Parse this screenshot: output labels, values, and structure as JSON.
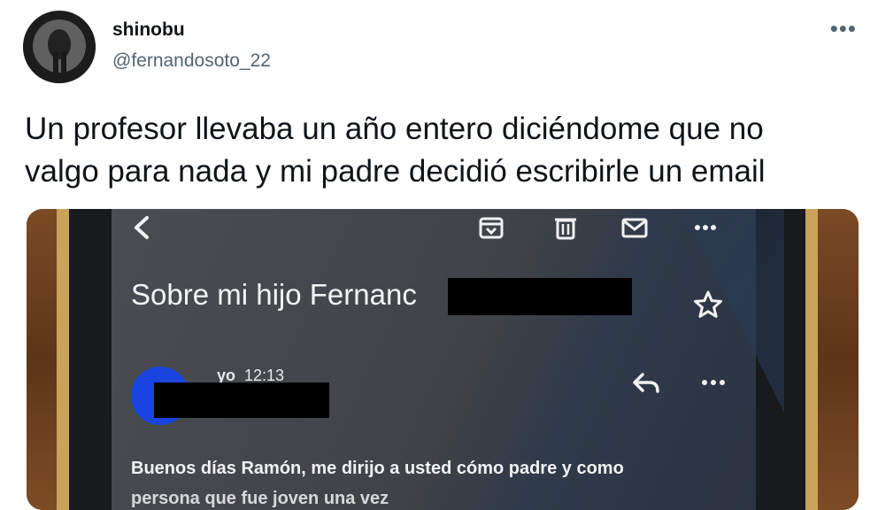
{
  "tweet": {
    "display_name": "shinobu",
    "handle": "@fernandosoto_22",
    "more_label": "•••",
    "text_line_1": "Un profesor llevaba un año entero diciéndome que no",
    "text_line_2": "valgo para nada y mi padre decidió escribirle un email"
  },
  "email": {
    "subject": "Sobre mi hijo Fernanc",
    "sender_label": "yo",
    "time": "12:13",
    "body_line_1": "Buenos días Ramón, me dirijo a usted cómo padre y como",
    "body_line_2": "persona que fue joven una vez",
    "more_label": "•••"
  },
  "icons": [
    "avatar",
    "more-icon",
    "back-icon",
    "archive-icon",
    "delete-icon",
    "mail-icon",
    "star-icon",
    "reply-icon"
  ],
  "colors": {
    "text": "#0f1419",
    "secondary_text": "#536471",
    "sender_avatar": "#1a44e0",
    "screen": "#44474c"
  }
}
